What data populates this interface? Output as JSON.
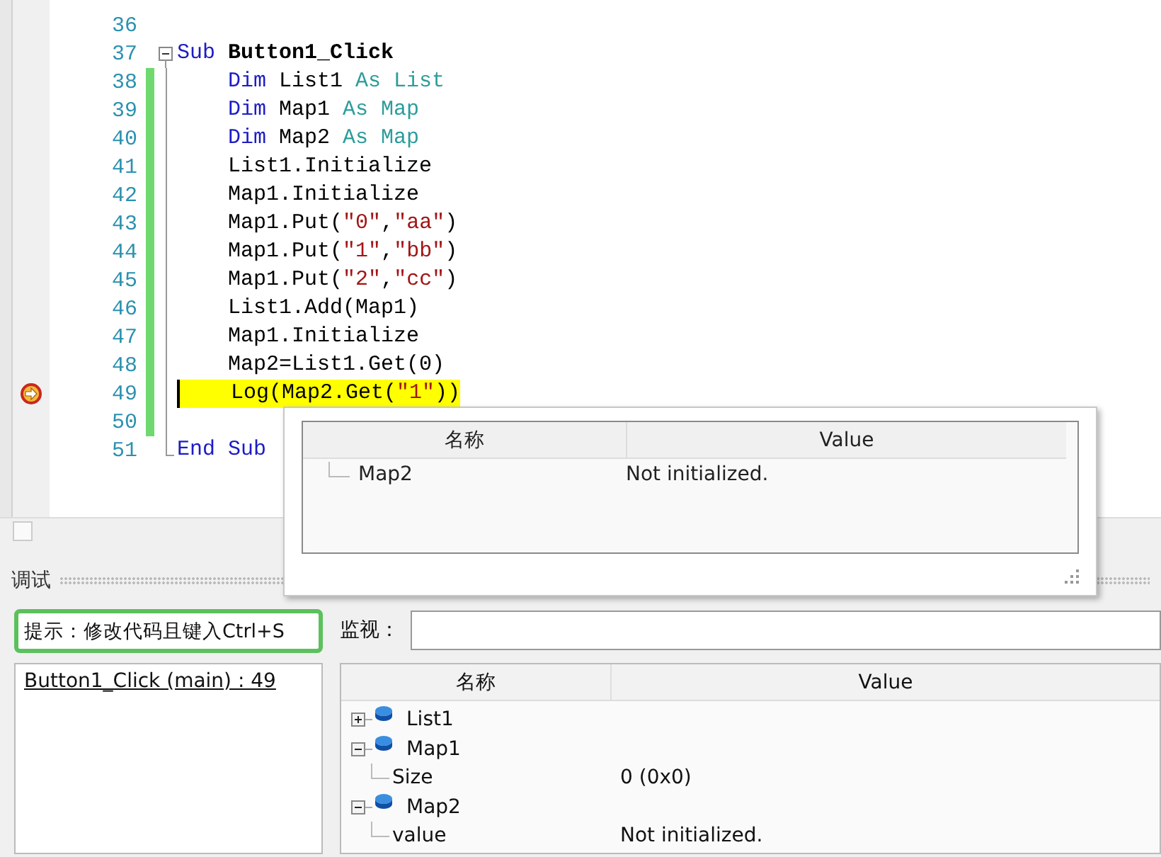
{
  "editor": {
    "lines": [
      {
        "number": "36",
        "changed": false,
        "current": false
      },
      {
        "number": "37",
        "changed": false,
        "current": false,
        "expanded": true,
        "tokens": [
          {
            "text": "Sub ",
            "kind": "keyword"
          },
          {
            "text": "Button1_Click",
            "kind": "name"
          }
        ]
      },
      {
        "number": "38",
        "changed": true,
        "current": false,
        "tokens": [
          {
            "text": "    Dim",
            "kind": "keyword"
          },
          {
            "text": " List1 ",
            "kind": "plain"
          },
          {
            "text": "As List",
            "kind": "type"
          }
        ]
      },
      {
        "number": "39",
        "changed": true,
        "current": false,
        "tokens": [
          {
            "text": "    Dim",
            "kind": "keyword"
          },
          {
            "text": " Map1 ",
            "kind": "plain"
          },
          {
            "text": "As Map",
            "kind": "type"
          }
        ]
      },
      {
        "number": "40",
        "changed": true,
        "current": false,
        "tokens": [
          {
            "text": "    Dim",
            "kind": "keyword"
          },
          {
            "text": " Map2 ",
            "kind": "plain"
          },
          {
            "text": "As Map",
            "kind": "type"
          }
        ]
      },
      {
        "number": "41",
        "changed": true,
        "current": false,
        "tokens": [
          {
            "text": "    List1.Initialize",
            "kind": "plain"
          }
        ]
      },
      {
        "number": "42",
        "changed": true,
        "current": false,
        "tokens": [
          {
            "text": "    Map1.Initialize",
            "kind": "plain"
          }
        ]
      },
      {
        "number": "43",
        "changed": true,
        "current": false,
        "tokens": [
          {
            "text": "    Map1.Put(",
            "kind": "plain"
          },
          {
            "text": "\"0\"",
            "kind": "string"
          },
          {
            "text": ",",
            "kind": "plain"
          },
          {
            "text": "\"aa\"",
            "kind": "string"
          },
          {
            "text": ")",
            "kind": "plain"
          }
        ]
      },
      {
        "number": "44",
        "changed": true,
        "current": false,
        "tokens": [
          {
            "text": "    Map1.Put(",
            "kind": "plain"
          },
          {
            "text": "\"1\"",
            "kind": "string"
          },
          {
            "text": ",",
            "kind": "plain"
          },
          {
            "text": "\"bb\"",
            "kind": "string"
          },
          {
            "text": ")",
            "kind": "plain"
          }
        ]
      },
      {
        "number": "45",
        "changed": true,
        "current": false,
        "tokens": [
          {
            "text": "    Map1.Put(",
            "kind": "plain"
          },
          {
            "text": "\"2\"",
            "kind": "string"
          },
          {
            "text": ",",
            "kind": "plain"
          },
          {
            "text": "\"cc\"",
            "kind": "string"
          },
          {
            "text": ")",
            "kind": "plain"
          }
        ]
      },
      {
        "number": "46",
        "changed": true,
        "current": false,
        "tokens": [
          {
            "text": "    List1.Add(Map1)",
            "kind": "plain"
          }
        ]
      },
      {
        "number": "47",
        "changed": true,
        "current": false,
        "tokens": [
          {
            "text": "    Map1.Initialize",
            "kind": "plain"
          }
        ]
      },
      {
        "number": "48",
        "changed": true,
        "current": false,
        "tokens": [
          {
            "text": "    Map2=List1.Get(0)",
            "kind": "plain"
          }
        ]
      },
      {
        "number": "49",
        "changed": true,
        "current": true,
        "tokens": [
          {
            "text": "    Log(Map2.Get(",
            "kind": "plain"
          },
          {
            "text": "\"1\"",
            "kind": "string"
          },
          {
            "text": "))",
            "kind": "plain"
          }
        ]
      },
      {
        "number": "50",
        "changed": true,
        "current": false
      },
      {
        "number": "51",
        "changed": false,
        "current": false,
        "tokens": [
          {
            "text": "End Sub",
            "kind": "keyword"
          }
        ]
      }
    ]
  },
  "tooltip": {
    "columns": [
      "名称",
      "Value"
    ],
    "rows": [
      {
        "name": "Map2",
        "value": "Not initialized."
      }
    ]
  },
  "debug_panel": {
    "title": "调试",
    "hint": "提示：修改代码且键入Ctrl+S",
    "watch_label": "监视：",
    "call_stack": [
      {
        "text": "Button1_Click (main) : 49"
      }
    ],
    "watch": {
      "columns": [
        "名称",
        "Value"
      ],
      "rows": [
        {
          "name": "List1",
          "expanded": false
        },
        {
          "name": "Map1",
          "expanded": true,
          "children": [
            {
              "name": "Size",
              "value": "0 (0x0)"
            }
          ]
        },
        {
          "name": "Map2",
          "expanded": true,
          "children": [
            {
              "name": "value",
              "value": "Not initialized."
            }
          ]
        }
      ]
    }
  }
}
